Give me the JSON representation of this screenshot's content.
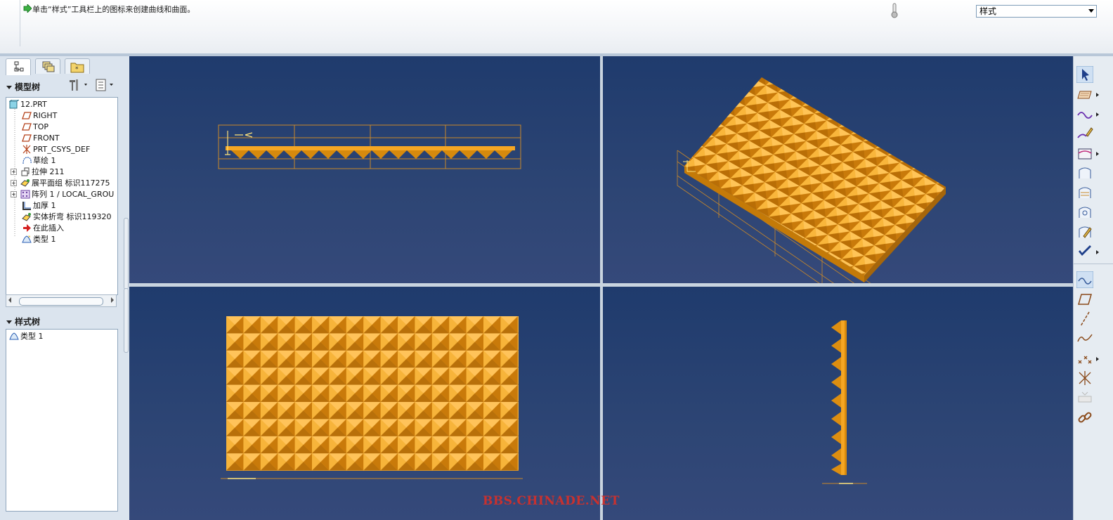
{
  "message_bar": {
    "text": "单击“样式”工具栏上的图标来创建曲线和曲面。",
    "icon": "green-arrow-icon"
  },
  "style_dropdown": {
    "selected": "样式"
  },
  "left_panel": {
    "tabs": [
      "model-tree-tab",
      "layers-tab",
      "favorites-tab"
    ],
    "model_tree_title": "模型树",
    "model_tree": [
      {
        "label": "12.PRT",
        "icon": "part-icon",
        "expander": false
      },
      {
        "label": "RIGHT",
        "icon": "datum-plane-icon",
        "expander": false
      },
      {
        "label": "TOP",
        "icon": "datum-plane-icon",
        "expander": false
      },
      {
        "label": "FRONT",
        "icon": "datum-plane-icon",
        "expander": false
      },
      {
        "label": "PRT_CSYS_DEF",
        "icon": "csys-icon",
        "expander": false
      },
      {
        "label": "草绘 1",
        "icon": "sketch-icon",
        "expander": false
      },
      {
        "label": "拉伸 211",
        "icon": "extrude-icon",
        "expander": true
      },
      {
        "label": "展平面组 标识117275",
        "icon": "flatten-quilt-icon",
        "expander": true
      },
      {
        "label": "阵列 1 / LOCAL_GROU",
        "icon": "pattern-icon",
        "expander": true
      },
      {
        "label": "加厚 1",
        "icon": "thicken-icon",
        "expander": false
      },
      {
        "label": "实体折弯 标识119320",
        "icon": "solid-bend-icon",
        "expander": false
      },
      {
        "label": "在此插入",
        "icon": "insert-here-icon",
        "expander": false
      },
      {
        "label": "类型 1",
        "icon": "style-feature-icon",
        "expander": false
      }
    ],
    "style_tree_title": "样式树",
    "style_tree": [
      {
        "label": "类型 1",
        "icon": "style-feature-icon"
      }
    ]
  },
  "viewports": {
    "top_left": "front-view",
    "top_right": "isometric-view",
    "bottom_left": "top-view",
    "bottom_right": "side-view"
  },
  "colors": {
    "viewport_top": "#1f3b6d",
    "viewport_bottom": "#35497a",
    "model_orange": "#f5a623",
    "model_dark": "#b86e00",
    "datum_line": "#c8882a"
  },
  "right_toolbar": [
    "select-arrow-icon",
    "plane-icon",
    "curve-icon",
    "curve-edit-icon",
    "surface-icon",
    "boundary-surface-icon",
    "connect-icon",
    "trim-icon",
    "surface-edit-icon",
    "done-check-icon",
    "curvature-icon",
    "datum-plane-icon",
    "axis-icon",
    "sketch-curve-icon",
    "point-icon",
    "csys-icon",
    "disabled-tool-icon",
    "link-icon"
  ],
  "watermark": "BBS.CHINADE.NET"
}
